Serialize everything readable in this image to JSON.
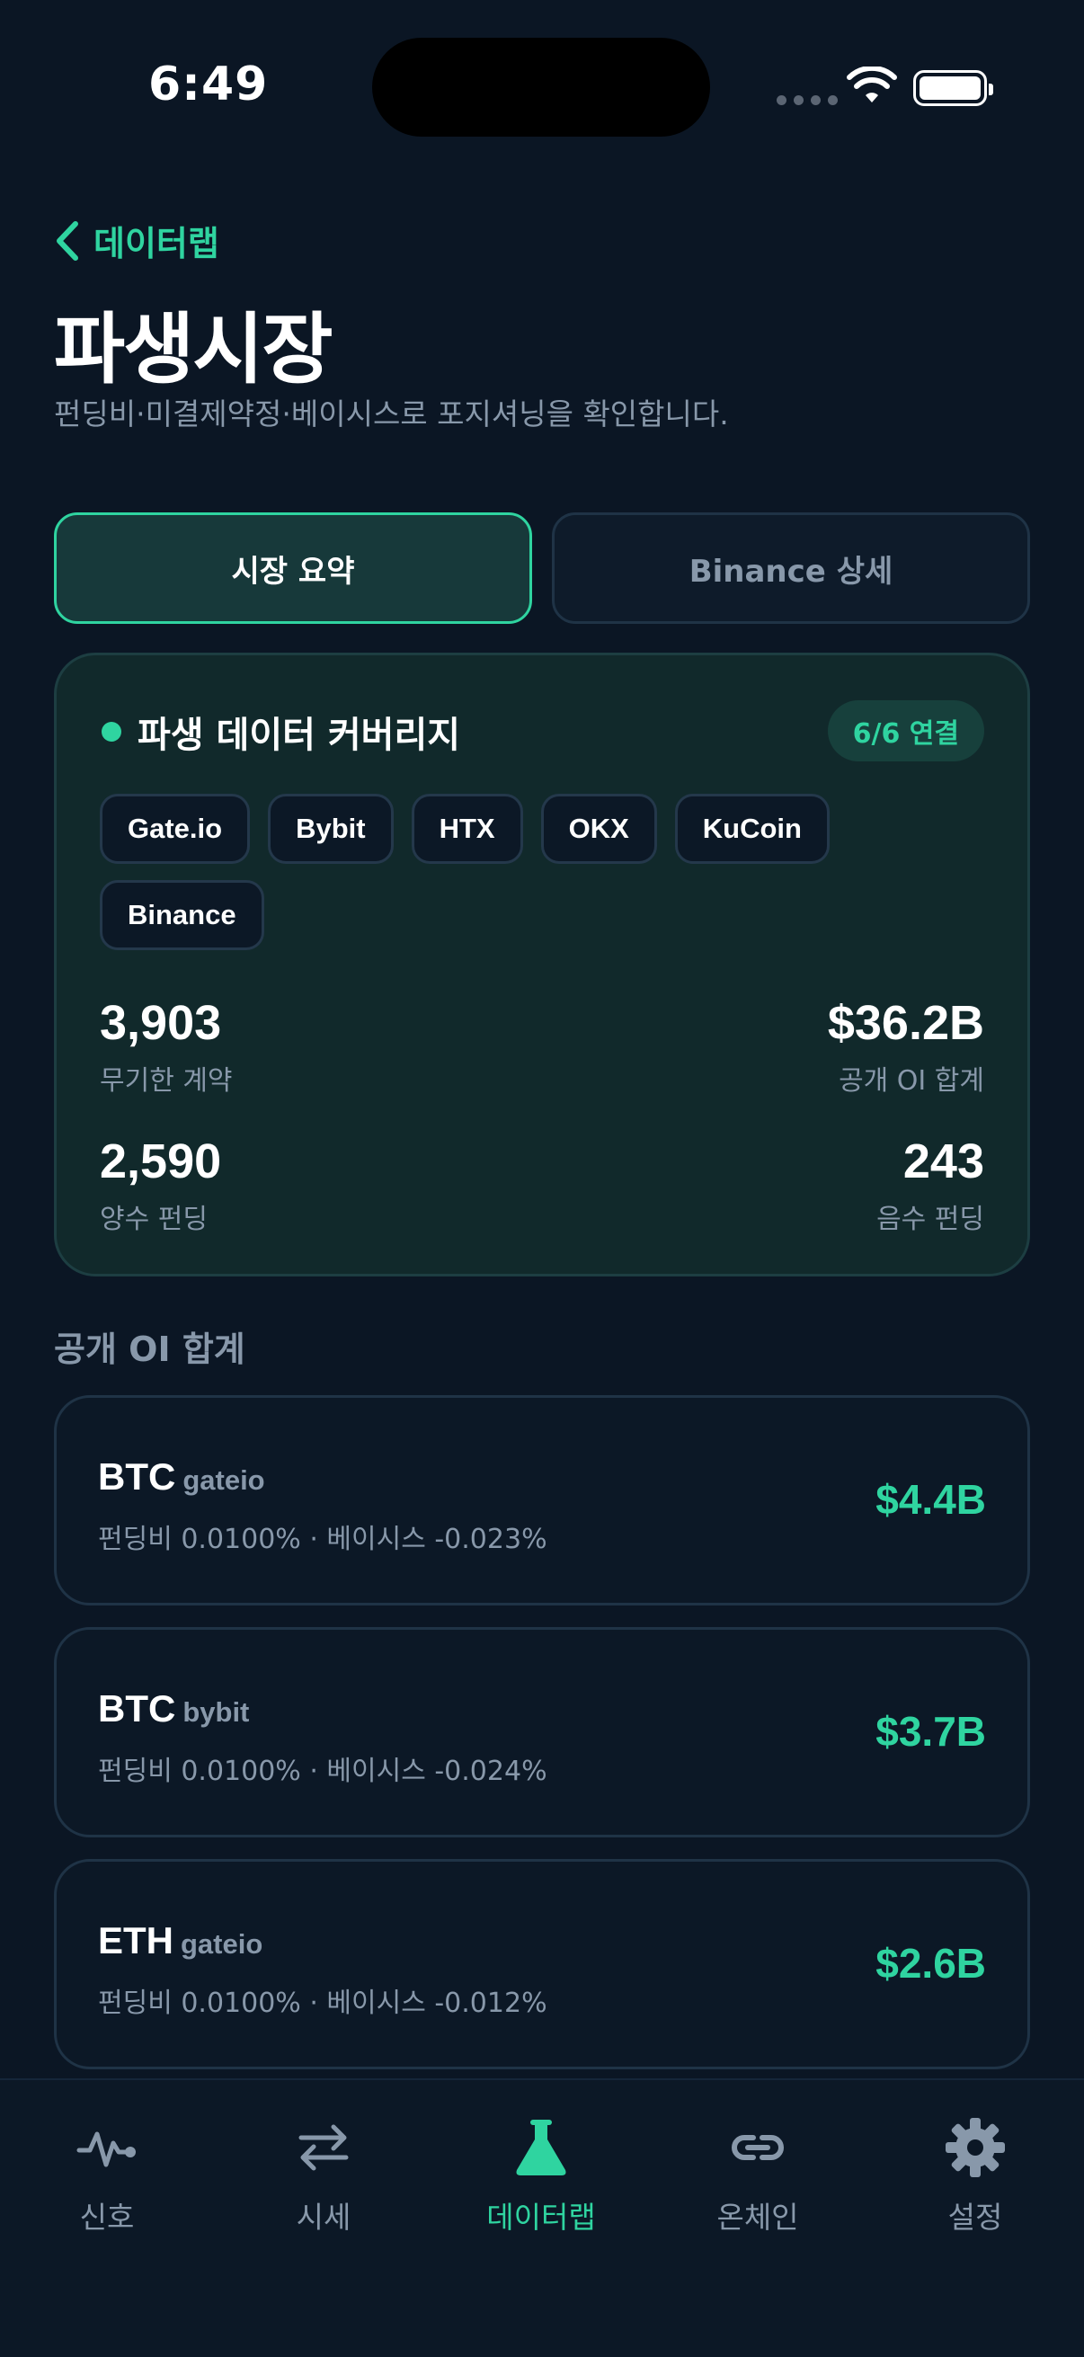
{
  "status_bar": {
    "time": "6:49"
  },
  "header": {
    "back_label": "데이터랩",
    "title": "파생시장",
    "subtitle": "펀딩비·미결제약정·베이시스로 포지셔닝을 확인합니다."
  },
  "tabs": [
    {
      "label": "시장 요약",
      "active": true
    },
    {
      "label": "Binance 상세",
      "active": false
    }
  ],
  "coverage": {
    "title": "파생 데이터 커버리지",
    "badge": "6/6 연결",
    "exchanges": [
      "Gate.io",
      "Bybit",
      "HTX",
      "OKX",
      "KuCoin",
      "Binance"
    ],
    "stats": [
      {
        "value": "3,903",
        "label": "무기한 계약"
      },
      {
        "value": "$36.2B",
        "label": "공개 OI 합계"
      },
      {
        "value": "2,590",
        "label": "양수 펀딩"
      },
      {
        "value": "243",
        "label": "음수 펀딩"
      }
    ]
  },
  "section_title": "공개 OI 합계",
  "oi_list": [
    {
      "symbol": "BTC",
      "exchange": "gateio",
      "meta": "펀딩비 0.0100% · 베이시스 -0.023%",
      "value": "$4.4B"
    },
    {
      "symbol": "BTC",
      "exchange": "bybit",
      "meta": "펀딩비 0.0100% · 베이시스 -0.024%",
      "value": "$3.7B"
    },
    {
      "symbol": "ETH",
      "exchange": "gateio",
      "meta": "펀딩비 0.0100% · 베이시스 -0.012%",
      "value": "$2.6B"
    }
  ],
  "nav": [
    {
      "label": "신호",
      "icon": "pulse-icon",
      "active": false
    },
    {
      "label": "시세",
      "icon": "swap-arrows-icon",
      "active": false
    },
    {
      "label": "데이터랩",
      "icon": "flask-icon",
      "active": true
    },
    {
      "label": "온체인",
      "icon": "link-icon",
      "active": false
    },
    {
      "label": "설정",
      "icon": "gear-icon",
      "active": false
    }
  ],
  "colors": {
    "accent": "#2fd4a0",
    "background": "#0b1624",
    "muted": "#8898aa"
  }
}
